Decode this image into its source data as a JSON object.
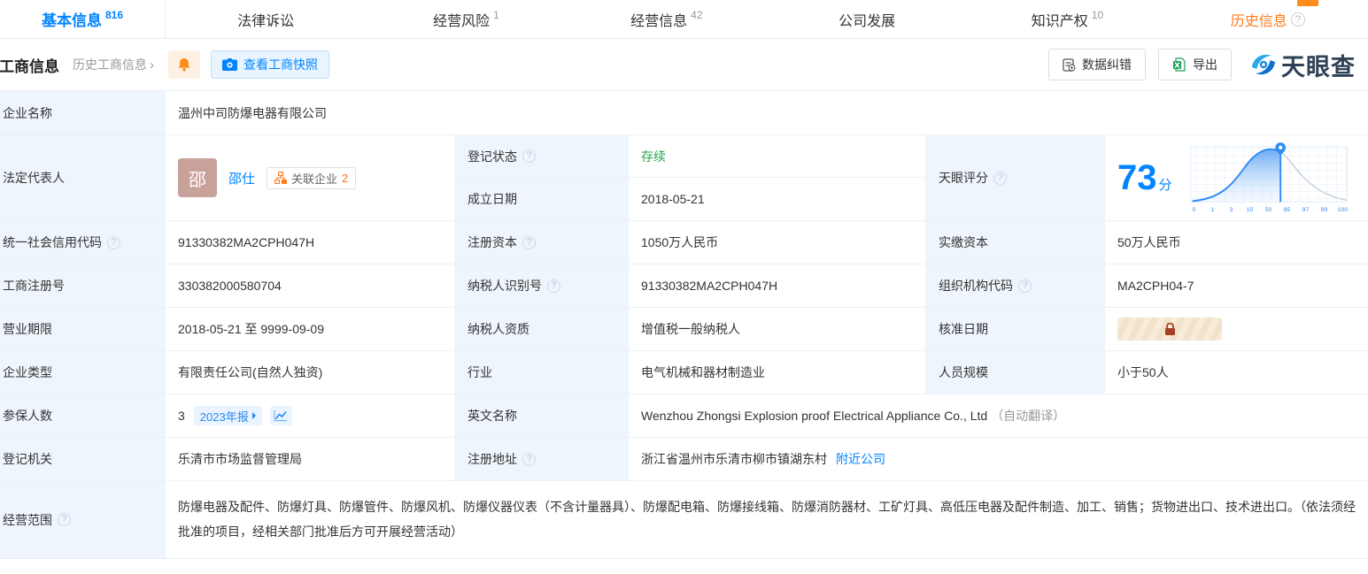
{
  "tabs": [
    {
      "label": "基本信息",
      "count": "816",
      "active": true
    },
    {
      "label": "法律诉讼",
      "count": ""
    },
    {
      "label": "经营风险",
      "count": "1"
    },
    {
      "label": "经营信息",
      "count": "42"
    },
    {
      "label": "公司发展",
      "count": ""
    },
    {
      "label": "知识产权",
      "count": "10"
    },
    {
      "label": "历史信息",
      "count": ""
    }
  ],
  "section_header": {
    "title": "工商信息",
    "history_link": "历史工商信息",
    "snapshot_button": "查看工商快照",
    "correction_button": "数据纠错",
    "export_button": "导出",
    "logo_text": "天眼查"
  },
  "table": {
    "company_name": {
      "label": "企业名称",
      "value": "温州中司防爆电器有限公司"
    },
    "legal_rep": {
      "label": "法定代表人",
      "avatar_char": "邵",
      "name": "邵仕",
      "related_label": "关联企业",
      "related_count": "2"
    },
    "reg_status": {
      "label": "登记状态",
      "value": "存续"
    },
    "establish_date": {
      "label": "成立日期",
      "value": "2018-05-21"
    },
    "score": {
      "label": "天眼评分",
      "value": "73",
      "unit": "分"
    },
    "credit_code": {
      "label": "统一社会信用代码",
      "value": "91330382MA2CPH047H"
    },
    "reg_capital": {
      "label": "注册资本",
      "value": "1050万人民币"
    },
    "paid_capital": {
      "label": "实缴资本",
      "value": "50万人民币"
    },
    "reg_number": {
      "label": "工商注册号",
      "value": "330382000580704"
    },
    "taxpayer_id": {
      "label": "纳税人识别号",
      "value": "91330382MA2CPH047H"
    },
    "org_code": {
      "label": "组织机构代码",
      "value": "MA2CPH04-7"
    },
    "business_term": {
      "label": "营业期限",
      "value": "2018-05-21 至 9999-09-09"
    },
    "taxpayer_quality": {
      "label": "纳税人资质",
      "value": "增值税一般纳税人"
    },
    "approval_date": {
      "label": "核准日期"
    },
    "company_type": {
      "label": "企业类型",
      "value": "有限责任公司(自然人独资)"
    },
    "industry": {
      "label": "行业",
      "value": "电气机械和器材制造业"
    },
    "staff_size": {
      "label": "人员规模",
      "value": "小于50人"
    },
    "insured_count": {
      "label": "参保人数",
      "value": "3",
      "report_tag": "2023年报"
    },
    "english_name": {
      "label": "英文名称",
      "value": "Wenzhou Zhongsi Explosion proof Electrical Appliance Co., Ltd",
      "suffix": "（自动翻译）"
    },
    "reg_authority": {
      "label": "登记机关",
      "value": "乐清市市场监督管理局"
    },
    "reg_address": {
      "label": "注册地址",
      "value": "浙江省温州市乐清市柳市镇湖东村",
      "nearby_link": "附近公司"
    },
    "business_scope": {
      "label": "经营范围",
      "value": "防爆电器及配件、防爆灯具、防爆管件、防爆风机、防爆仪器仪表（不含计量器具）、防爆配电箱、防爆接线箱、防爆消防器材、工矿灯具、高低压电器及配件制造、加工、销售；货物进出口、技术进出口。（依法须经批准的项目，经相关部门批准后方可开展经营活动）"
    }
  },
  "chart_data": {
    "type": "area",
    "title": "天眼评分",
    "x_ticks": [
      "0",
      "1",
      "3",
      "15",
      "50",
      "85",
      "97",
      "99",
      "100"
    ],
    "marker_value": 73,
    "score": 73,
    "legend_position": "none",
    "grid": true,
    "colors": {
      "curve": "#2f8df5",
      "curve_rest": "#c5cfdb",
      "grid": "#e2ecf9",
      "tick": "#2f8df5"
    }
  },
  "colors": {
    "accent_blue": "#0084ff",
    "orange": "#ff7a1c",
    "status_green": "#28a54c",
    "label_bg": "#eff5fc",
    "border": "#e9edf2",
    "avatar_bg": "#c8a19b",
    "lock_red": "#a63e22"
  }
}
